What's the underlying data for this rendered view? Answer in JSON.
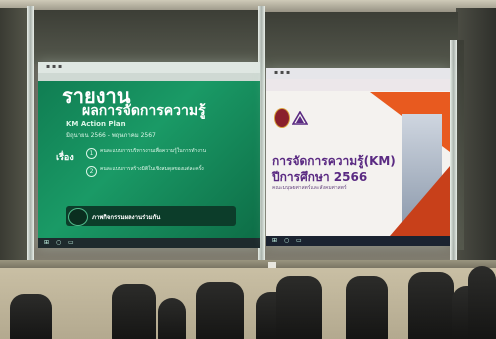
{
  "left_slide": {
    "title_line1": "รายงาน",
    "title_line2": "ผลการจัดการความรู้",
    "subtitle": "KM Action Plan",
    "date_range": "มิถุนายน 2566 - พฤษภาคม 2567",
    "topic_label": "เรื่อง",
    "item1": "คนละแบบการบริหารงานเพื่อความรู้ในการทำงาน",
    "item2": "คนละแบบการสร้างมิติในเชิงสมดุลของแต่ละครั้ง",
    "footer_label": "ภาพกิจกรรมผลงานร่วมกัน"
  },
  "right_slide": {
    "title": "การจัดการความรู้(KM)",
    "year": "ปีการศึกษา 2566",
    "faculty": "คณะมนุษยศาสตร์และสังคมศาสตร์"
  },
  "colors": {
    "left_slide_green": "#1a9a66",
    "right_accent_orange": "#e85a1f",
    "right_title_purple": "#5a2a82"
  },
  "icons": [
    "windows-icon",
    "university-seal-icon",
    "faculty-logo-icon"
  ]
}
